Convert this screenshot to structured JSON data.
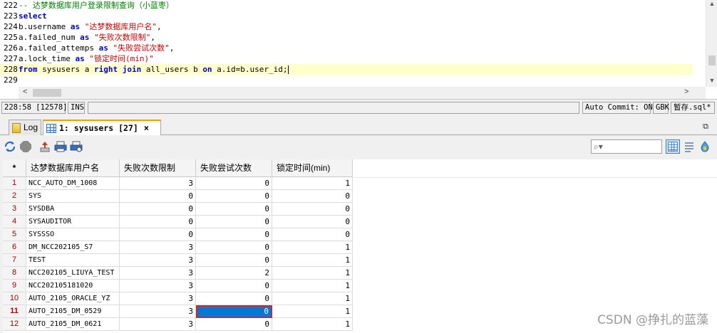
{
  "editor": {
    "lines": [
      {
        "n": "222",
        "current": false,
        "tokens": [
          {
            "t": "-- 达梦数据库用户登录限制查询（小蓝枣）",
            "c": "comment"
          }
        ]
      },
      {
        "n": "223",
        "current": false,
        "tokens": [
          {
            "t": "select",
            "c": "kw"
          }
        ]
      },
      {
        "n": "224",
        "current": false,
        "tokens": [
          {
            "t": "b.username ",
            "c": "plain"
          },
          {
            "t": "as",
            "c": "kw"
          },
          {
            "t": " \"达梦数据库用户名\"",
            "c": "str"
          },
          {
            "t": ",",
            "c": "plain"
          }
        ]
      },
      {
        "n": "225",
        "current": false,
        "tokens": [
          {
            "t": "a.failed_num ",
            "c": "plain"
          },
          {
            "t": "as",
            "c": "kw"
          },
          {
            "t": " \"失败次数限制\"",
            "c": "str"
          },
          {
            "t": ",",
            "c": "plain"
          }
        ]
      },
      {
        "n": "226",
        "current": false,
        "tokens": [
          {
            "t": "a.failed_attemps ",
            "c": "plain"
          },
          {
            "t": "as",
            "c": "kw"
          },
          {
            "t": " \"失败尝试次数\"",
            "c": "str"
          },
          {
            "t": ",",
            "c": "plain"
          }
        ]
      },
      {
        "n": "227",
        "current": false,
        "tokens": [
          {
            "t": "a.lock_time ",
            "c": "plain"
          },
          {
            "t": "as",
            "c": "kw"
          },
          {
            "t": " \"锁定时间(min)\"",
            "c": "str"
          }
        ]
      },
      {
        "n": "228",
        "current": true,
        "tokens": [
          {
            "t": "from",
            "c": "kw"
          },
          {
            "t": " sysusers a ",
            "c": "plain"
          },
          {
            "t": "right join",
            "c": "kw"
          },
          {
            "t": " all_users b ",
            "c": "plain"
          },
          {
            "t": "on",
            "c": "kw"
          },
          {
            "t": " a.id=b.user_id;",
            "c": "plain"
          }
        ]
      },
      {
        "n": "229",
        "current": false,
        "tokens": []
      }
    ]
  },
  "status": {
    "position": "228:58 [12578]",
    "mode": "INS",
    "auto_commit": "Auto Commit: ON",
    "encoding": "GBK",
    "file": "暂存.sql*"
  },
  "tabs": {
    "log_label": "Log",
    "result_label": "1: sysusers [27]",
    "close_glyph": "×"
  },
  "search": {
    "placeholder": ""
  },
  "grid": {
    "index_header": "*",
    "columns": [
      "达梦数据库用户名",
      "失败次数限制",
      "失败尝试次数",
      "锁定时间(min)"
    ],
    "rows": [
      [
        "1",
        "NCC_AUTO_DM_1008",
        "3",
        "0",
        "1"
      ],
      [
        "2",
        "SYS",
        "0",
        "0",
        "0"
      ],
      [
        "3",
        "SYSDBA",
        "0",
        "0",
        "0"
      ],
      [
        "4",
        "SYSAUDITOR",
        "0",
        "0",
        "0"
      ],
      [
        "5",
        "SYSSSO",
        "0",
        "0",
        "0"
      ],
      [
        "6",
        "DM_NCC202105_S7",
        "3",
        "0",
        "1"
      ],
      [
        "7",
        "TEST",
        "3",
        "0",
        "1"
      ],
      [
        "8",
        "NCC202105_LIUYA_TEST",
        "3",
        "2",
        "1"
      ],
      [
        "9",
        "NCC202105181020",
        "3",
        "0",
        "1"
      ],
      [
        "10",
        "AUTO_2105_ORACLE_YZ",
        "3",
        "0",
        "1"
      ],
      [
        "11",
        "AUTO_2105_DM_0529",
        "3",
        "0",
        "1"
      ],
      [
        "12",
        "AUTO_2105_DM_0621",
        "3",
        "0",
        "1"
      ]
    ],
    "selected_row": 11,
    "selected_col": 3
  },
  "watermark": "CSDN @挣扎的蓝藻",
  "colors": {
    "keyword": "#0000c0",
    "string": "#d00000",
    "comment": "#008000",
    "selection": "#0078d7",
    "selection_border": "#e02020",
    "current_line": "#ffffcc",
    "tab_accent": "#ff9900"
  }
}
